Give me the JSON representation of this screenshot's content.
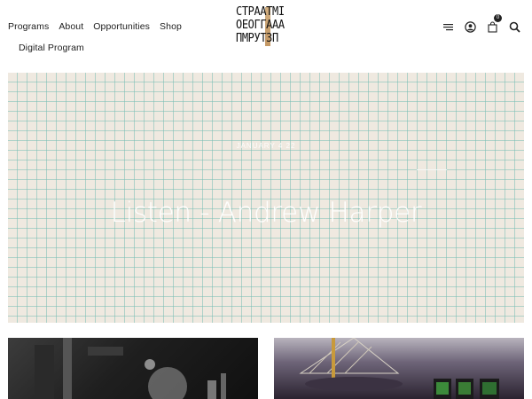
{
  "nav": {
    "items": [
      "Programs",
      "About",
      "Opportunities",
      "Shop"
    ],
    "second_row": [
      "Digital Program"
    ]
  },
  "logo": {
    "lines": [
      "CTPAATMI",
      "OEOГГААА",
      "ПМРУТЗП"
    ]
  },
  "header_icons": [
    "menu-icon",
    "account-icon",
    "cart-icon",
    "search-icon"
  ],
  "cart": {
    "count": "0"
  },
  "hero": {
    "date": "JANUARY 4 22",
    "title": "Listen - Andrew Harper"
  },
  "colors": {
    "hero_bg": "#efe9e0",
    "grid_line": "#78beb4",
    "accent_logo": "#c9a06a",
    "text": "#1d1d1d"
  }
}
